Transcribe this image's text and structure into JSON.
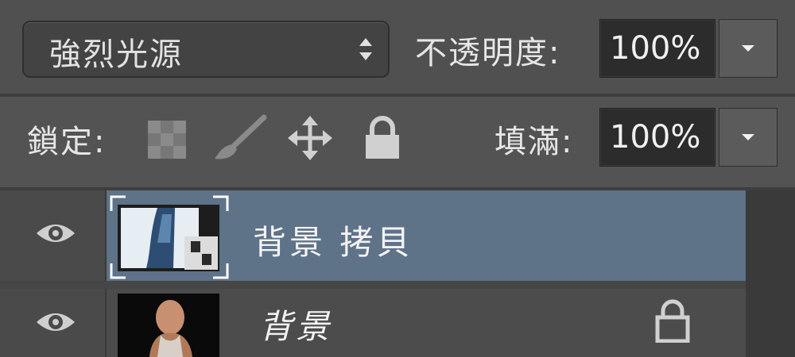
{
  "blend_mode": {
    "value": "強烈光源",
    "icon": "updown-arrows-icon"
  },
  "opacity": {
    "label": "不透明度:",
    "value": "100%"
  },
  "lock": {
    "label": "鎖定:",
    "icons": [
      "transparency-lock-icon",
      "brush-icon",
      "move-icon",
      "padlock-icon"
    ]
  },
  "fill": {
    "label": "填滿:",
    "value": "100%"
  },
  "layers": [
    {
      "name": "背景 拷貝",
      "visible": true,
      "selected": true,
      "locked": false
    },
    {
      "name": "背景",
      "visible": true,
      "selected": false,
      "locked": true
    }
  ],
  "colors": {
    "panel": "#535353",
    "selected": "#5e7288"
  }
}
